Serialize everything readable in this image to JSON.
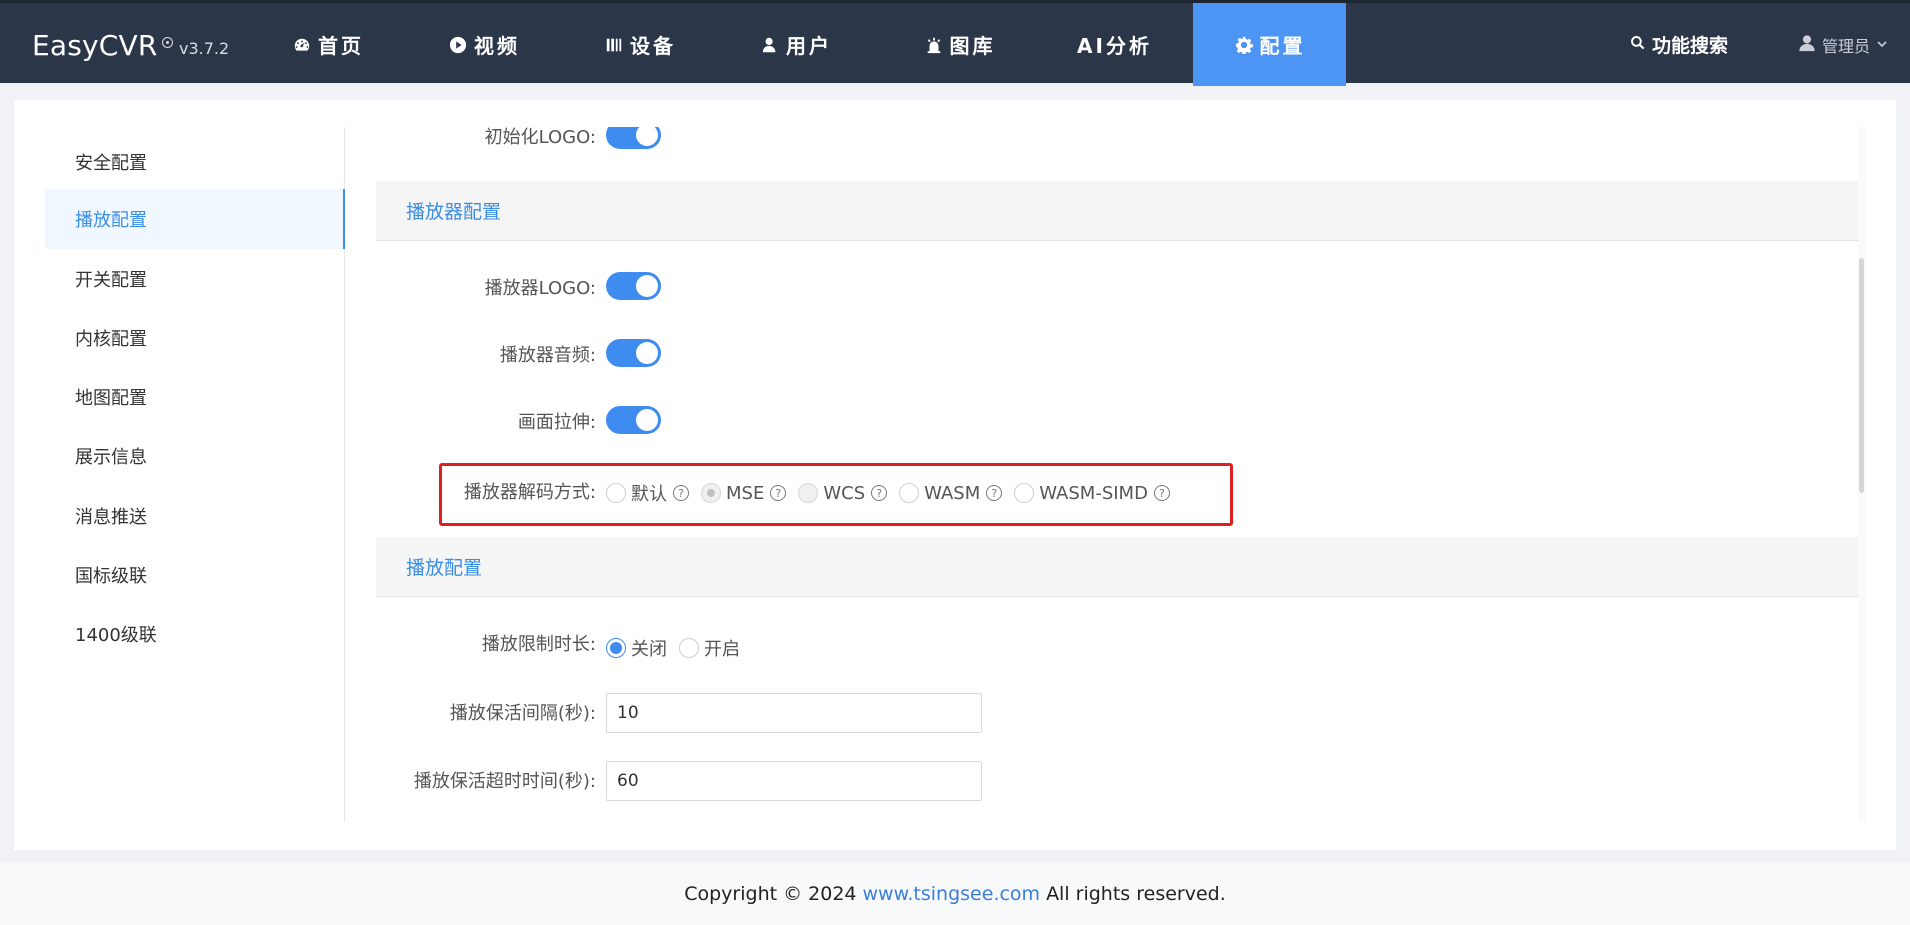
{
  "app": {
    "brand": "EasyCVR",
    "version": "v3.7.2"
  },
  "nav": {
    "items": [
      {
        "label": "首页",
        "icon": "dashboard-icon"
      },
      {
        "label": "视频",
        "icon": "play-circle-icon"
      },
      {
        "label": "设备",
        "icon": "server-icon"
      },
      {
        "label": "用户",
        "icon": "user-icon"
      },
      {
        "label": "图库",
        "icon": "alarm-icon"
      },
      {
        "label": "AI分析",
        "icon": ""
      },
      {
        "label": "配置",
        "icon": "gear-icon",
        "active": true
      }
    ],
    "search_label": "功能搜索",
    "user_label": "管理员"
  },
  "sidebar": {
    "items": [
      {
        "label": "安全配置"
      },
      {
        "label": "播放配置",
        "active": true
      },
      {
        "label": "开关配置"
      },
      {
        "label": "内核配置"
      },
      {
        "label": "地图配置"
      },
      {
        "label": "展示信息"
      },
      {
        "label": "消息推送"
      },
      {
        "label": "国标级联"
      },
      {
        "label": "1400级联"
      }
    ]
  },
  "form": {
    "init_logo_label": "初始化LOGO:",
    "init_logo_on": true,
    "player_section_title": "播放器配置",
    "player_logo_label": "播放器LOGO:",
    "player_logo_on": true,
    "player_audio_label": "播放器音频:",
    "player_audio_on": true,
    "stretch_label": "画面拉伸:",
    "stretch_on": true,
    "decode_label": "播放器解码方式:",
    "decode_options": [
      {
        "label": "默认",
        "state": "unselected"
      },
      {
        "label": "MSE",
        "state": "disabled-selected"
      },
      {
        "label": "WCS",
        "state": "disabled"
      },
      {
        "label": "WASM",
        "state": "unselected"
      },
      {
        "label": "WASM-SIMD",
        "state": "unselected"
      }
    ],
    "play_section_title": "播放配置",
    "limit_label": "播放限制时长:",
    "limit_options": [
      {
        "label": "关闭",
        "selected": true
      },
      {
        "label": "开启",
        "selected": false
      }
    ],
    "keepalive_interval_label": "播放保活间隔(秒):",
    "keepalive_interval_value": "10",
    "keepalive_timeout_label": "播放保活超时时间(秒):",
    "keepalive_timeout_value": "60"
  },
  "footer": {
    "prefix": "Copyright © 2024",
    "link": "www.tsingsee.com",
    "suffix": "All rights reserved."
  },
  "colors": {
    "nav_bg": "#2c3649",
    "nav_active": "#4d95f5",
    "accent": "#3a8ee6",
    "highlight_box": "#e02020"
  }
}
